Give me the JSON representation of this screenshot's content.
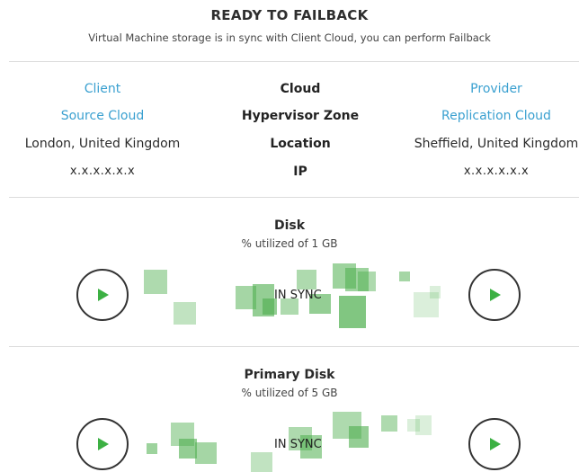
{
  "header": {
    "title": "READY TO FAILBACK",
    "subtitle": "Virtual Machine storage is in sync with Client Cloud, you can perform Failback"
  },
  "info": {
    "rows": [
      {
        "left": "Client",
        "middle": "Cloud",
        "right": "Provider"
      },
      {
        "left": "Source Cloud",
        "middle": "Hypervisor Zone",
        "right": "Replication Cloud"
      },
      {
        "left": "London, United Kingdom",
        "middle": "Location",
        "right": "Sheffield, United Kingdom"
      },
      {
        "left": "x.x.x.x.x.x",
        "middle": "IP",
        "right": "x.x.x.x.x.x"
      }
    ]
  },
  "disks": [
    {
      "name": "Disk",
      "usage": "% utilized of 1 GB",
      "status": "IN SYNC"
    },
    {
      "name": "Primary Disk",
      "usage": "% utilized of 5 GB",
      "status": "IN SYNC"
    }
  ],
  "colors": {
    "accent_blue": "#3aa0d0",
    "sync_green": "#4cae4c",
    "play_green": "#3cb043"
  },
  "icons": {
    "play": "play-icon"
  }
}
